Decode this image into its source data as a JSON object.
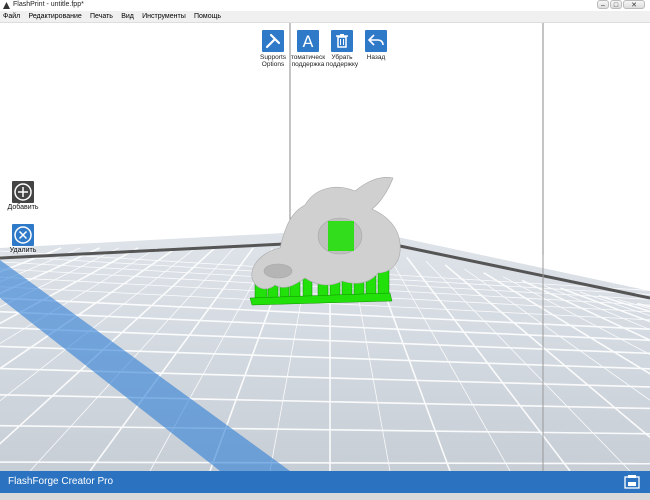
{
  "window": {
    "title": "FlashPrint - untitle.fpp*"
  },
  "menu": [
    "Файл",
    "Редактирование",
    "Печать",
    "Вид",
    "Инструменты",
    "Помощь"
  ],
  "toolbar": {
    "supports_options": "Supports\nOptions",
    "auto_support": "томатическ\nподдержка",
    "remove_support": "Убрать\nподдержку",
    "back": "Назад"
  },
  "side": {
    "add": "Добавить",
    "remove": "Удалить"
  },
  "status": {
    "printer": "FlashForge Creator Pro"
  },
  "colors": {
    "accent": "#2e7ac9",
    "status_bar": "#2b73c0",
    "support": "#22e00a",
    "model": "#cfcfcf"
  }
}
